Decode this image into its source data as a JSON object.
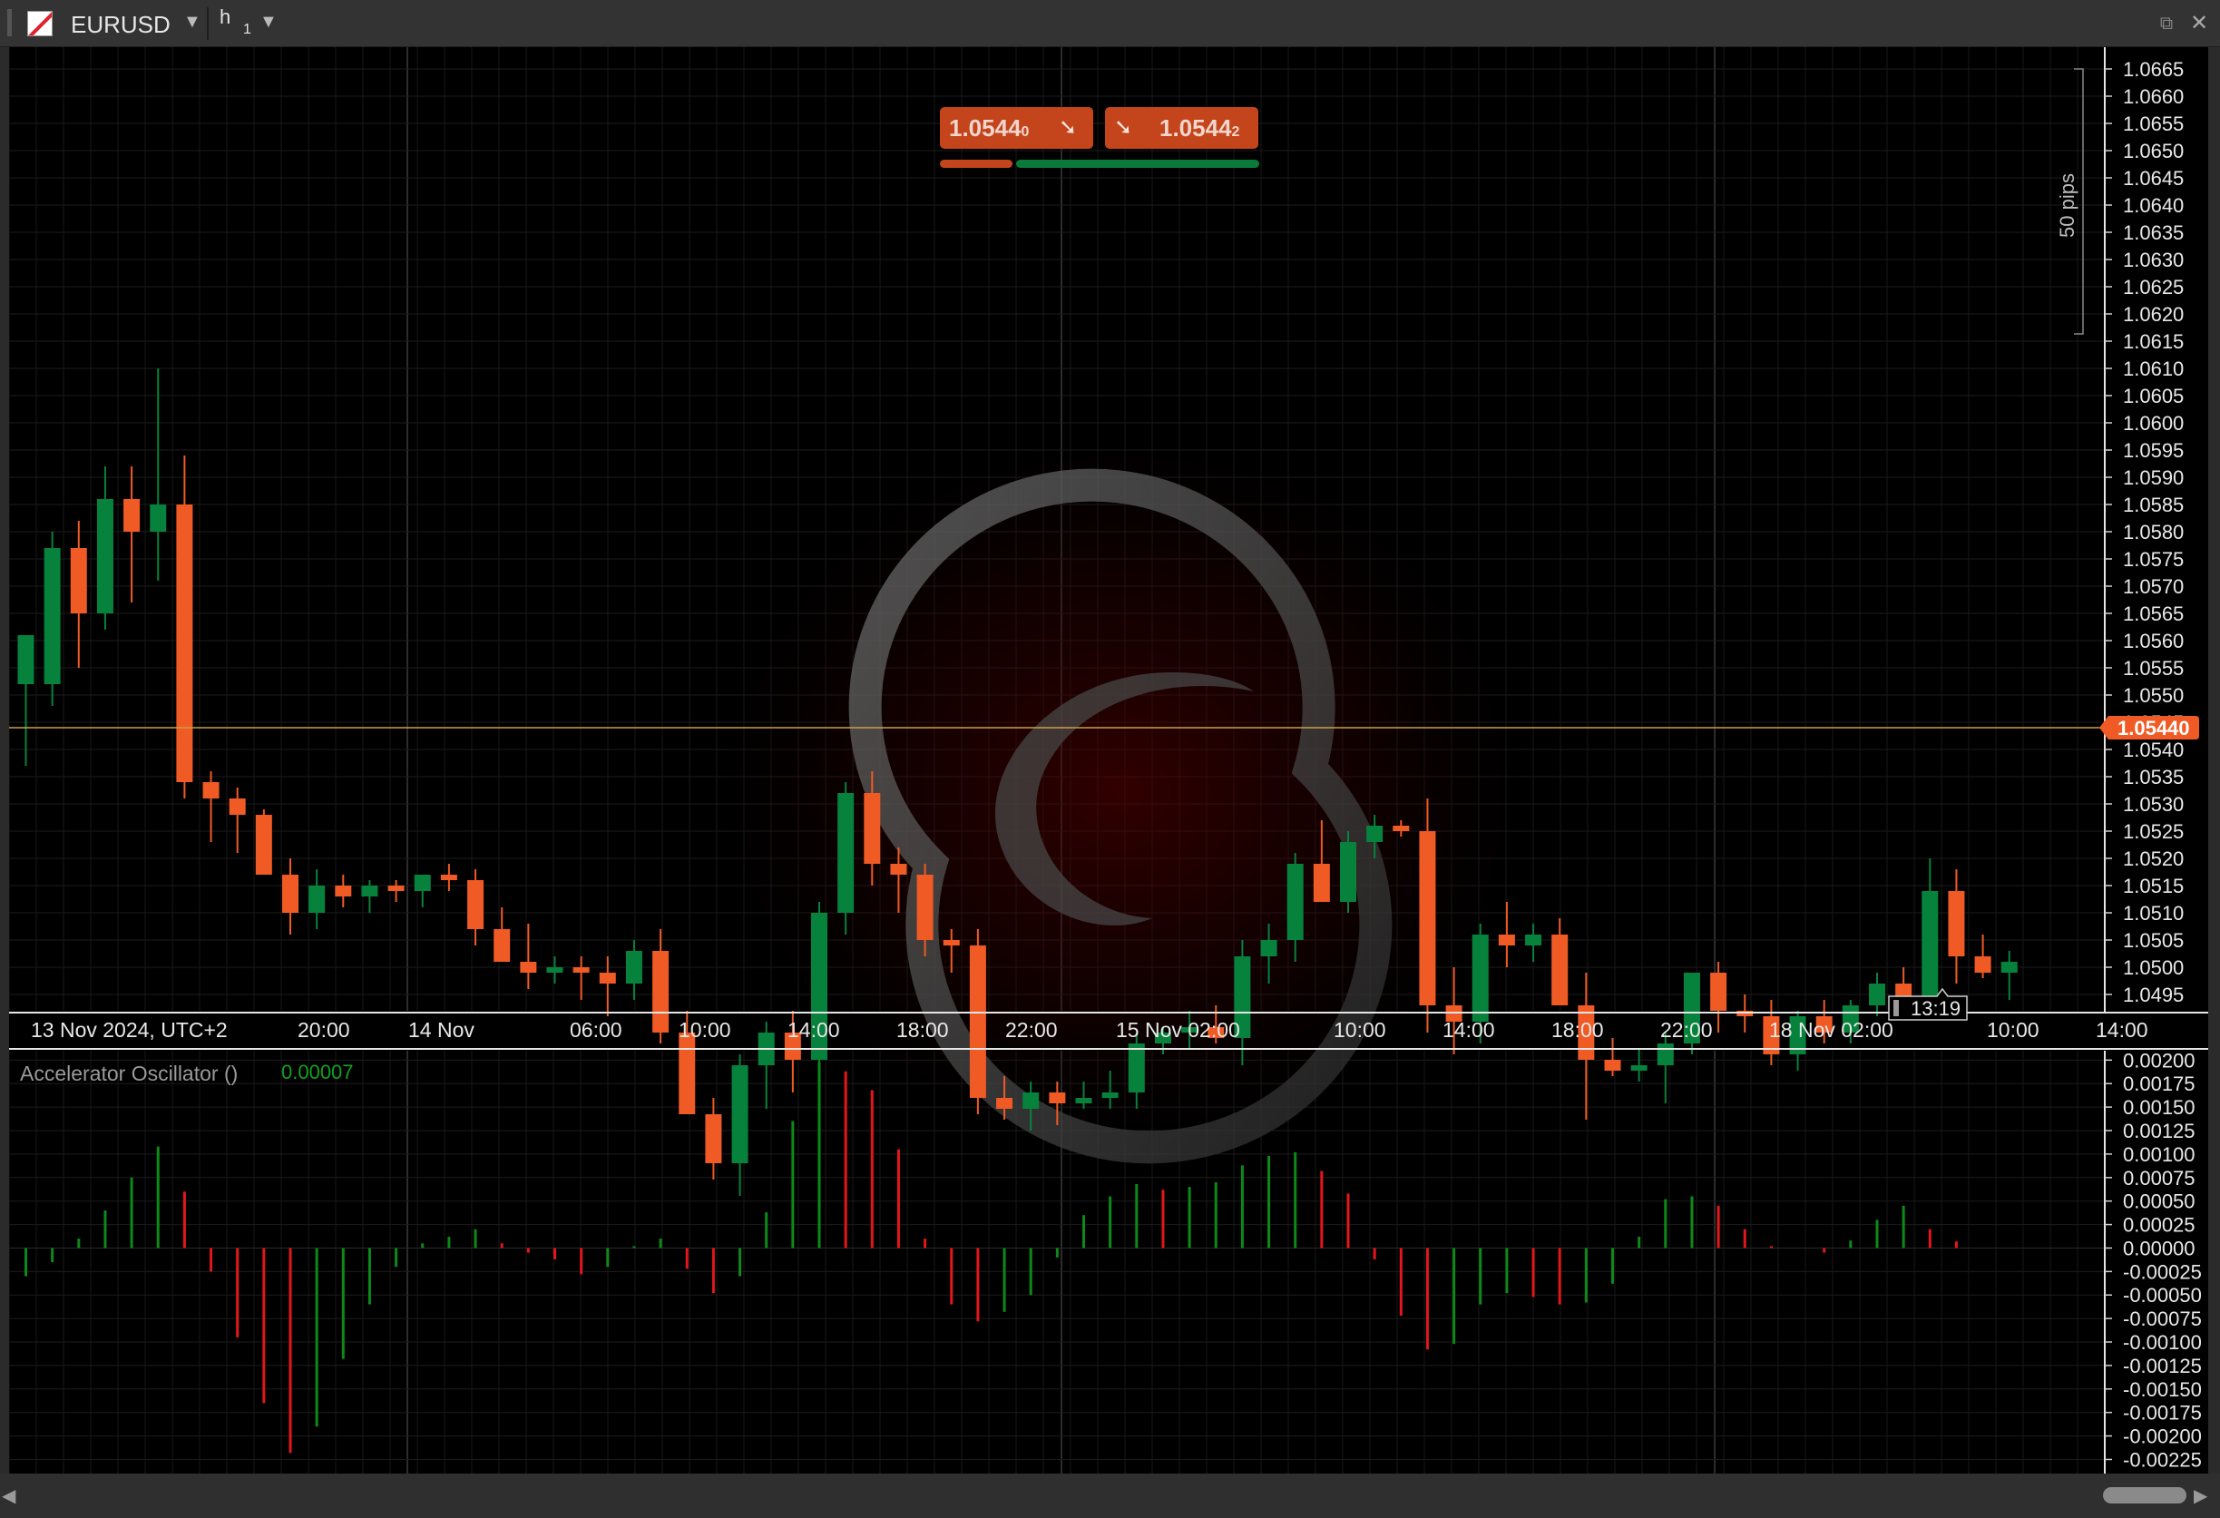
{
  "window": {
    "symbol": "EURUSD",
    "timeframe_letter": "h",
    "timeframe_number": "1"
  },
  "trade": {
    "sell_price_main": "1.0544",
    "sell_price_pip": "0",
    "buy_price_main": "1.0544",
    "buy_price_pip": "2"
  },
  "chart_data": [
    {
      "type": "candlestick",
      "series_name": "EURUSD h1",
      "current_price_label": "1.05440",
      "current_price": 1.0544,
      "pips_label": "50 pips",
      "countdown_label": "13:19",
      "colors": {
        "up": "#07823c",
        "down": "#f05a24",
        "background": "#000000",
        "price_line": "#c8a04a"
      },
      "ylim": [
        1.0492,
        1.0669
      ],
      "y_ticks": [
        "1.0665",
        "1.0660",
        "1.0655",
        "1.0650",
        "1.0645",
        "1.0640",
        "1.0635",
        "1.0630",
        "1.0625",
        "1.0620",
        "1.0615",
        "1.0610",
        "1.0605",
        "1.0600",
        "1.0595",
        "1.0590",
        "1.0585",
        "1.0580",
        "1.0575",
        "1.0570",
        "1.0565",
        "1.0560",
        "1.0555",
        "1.0550",
        "1.0545",
        "1.0540",
        "1.0535",
        "1.0530",
        "1.0525",
        "1.0520",
        "1.0515",
        "1.0510",
        "1.0505",
        "1.0500",
        "1.0495"
      ],
      "x_ticks": [
        "13 Nov 2024, UTC+2",
        "20:00",
        "14 Nov",
        "06:00",
        "10:00",
        "14:00",
        "18:00",
        "22:00",
        "15 Nov 02:00",
        "10:00",
        "14:00",
        "18:00",
        "22:00",
        "18 Nov 02:00",
        "10:00",
        "14:00"
      ],
      "candles": [
        {
          "o": 1.0552,
          "h": 1.0561,
          "l": 1.0537,
          "c": 1.0561
        },
        {
          "o": 1.0552,
          "h": 1.058,
          "l": 1.0548,
          "c": 1.0577
        },
        {
          "o": 1.0577,
          "h": 1.0582,
          "l": 1.0555,
          "c": 1.0565
        },
        {
          "o": 1.0565,
          "h": 1.0592,
          "l": 1.0562,
          "c": 1.0586
        },
        {
          "o": 1.0586,
          "h": 1.0592,
          "l": 1.0567,
          "c": 1.058
        },
        {
          "o": 1.058,
          "h": 1.061,
          "l": 1.0571,
          "c": 1.0585
        },
        {
          "o": 1.0585,
          "h": 1.0594,
          "l": 1.0531,
          "c": 1.0534
        },
        {
          "o": 1.0534,
          "h": 1.0536,
          "l": 1.0523,
          "c": 1.0531
        },
        {
          "o": 1.0531,
          "h": 1.0533,
          "l": 1.0521,
          "c": 1.0528
        },
        {
          "o": 1.0528,
          "h": 1.0529,
          "l": 1.0518,
          "c": 1.0517
        },
        {
          "o": 1.0517,
          "h": 1.052,
          "l": 1.0506,
          "c": 1.051
        },
        {
          "o": 1.051,
          "h": 1.0518,
          "l": 1.0507,
          "c": 1.0515
        },
        {
          "o": 1.0515,
          "h": 1.0517,
          "l": 1.0511,
          "c": 1.0513
        },
        {
          "o": 1.0513,
          "h": 1.0516,
          "l": 1.051,
          "c": 1.0515
        },
        {
          "o": 1.0515,
          "h": 1.0516,
          "l": 1.0512,
          "c": 1.0514
        },
        {
          "o": 1.0514,
          "h": 1.0517,
          "l": 1.0511,
          "c": 1.0517
        },
        {
          "o": 1.0517,
          "h": 1.0519,
          "l": 1.0514,
          "c": 1.0516
        },
        {
          "o": 1.0516,
          "h": 1.0518,
          "l": 1.0504,
          "c": 1.0507
        },
        {
          "o": 1.0507,
          "h": 1.0511,
          "l": 1.0501,
          "c": 1.0501
        },
        {
          "o": 1.0501,
          "h": 1.0508,
          "l": 1.0496,
          "c": 1.0499
        },
        {
          "o": 1.0499,
          "h": 1.0502,
          "l": 1.0497,
          "c": 1.05
        },
        {
          "o": 1.05,
          "h": 1.0502,
          "l": 1.0494,
          "c": 1.0499
        },
        {
          "o": 1.0499,
          "h": 1.0502,
          "l": 1.0491,
          "c": 1.0497
        },
        {
          "o": 1.0497,
          "h": 1.0505,
          "l": 1.0494,
          "c": 1.0503
        },
        {
          "o": 1.0503,
          "h": 1.0507,
          "l": 1.0486,
          "c": 1.0488
        },
        {
          "o": 1.0488,
          "h": 1.0492,
          "l": 1.0474,
          "c": 1.0473
        },
        {
          "o": 1.0473,
          "h": 1.0476,
          "l": 1.0461,
          "c": 1.0464
        },
        {
          "o": 1.0464,
          "h": 1.0484,
          "l": 1.0458,
          "c": 1.0482
        },
        {
          "o": 1.0482,
          "h": 1.049,
          "l": 1.0474,
          "c": 1.0488
        },
        {
          "o": 1.0488,
          "h": 1.0492,
          "l": 1.0477,
          "c": 1.0483
        },
        {
          "o": 1.0483,
          "h": 1.0512,
          "l": 1.0481,
          "c": 1.051
        },
        {
          "o": 1.051,
          "h": 1.0534,
          "l": 1.0506,
          "c": 1.0532
        },
        {
          "o": 1.0532,
          "h": 1.0536,
          "l": 1.0515,
          "c": 1.0519
        },
        {
          "o": 1.0519,
          "h": 1.0522,
          "l": 1.051,
          "c": 1.0517
        },
        {
          "o": 1.0517,
          "h": 1.0519,
          "l": 1.0502,
          "c": 1.0505
        },
        {
          "o": 1.0505,
          "h": 1.0507,
          "l": 1.0499,
          "c": 1.0504
        },
        {
          "o": 1.0504,
          "h": 1.0507,
          "l": 1.0473,
          "c": 1.0476
        },
        {
          "o": 1.0476,
          "h": 1.048,
          "l": 1.0472,
          "c": 1.0474
        },
        {
          "o": 1.0474,
          "h": 1.0479,
          "l": 1.047,
          "c": 1.0477
        },
        {
          "o": 1.0477,
          "h": 1.0479,
          "l": 1.0471,
          "c": 1.0475
        },
        {
          "o": 1.0475,
          "h": 1.0479,
          "l": 1.0474,
          "c": 1.0476
        },
        {
          "o": 1.0476,
          "h": 1.0481,
          "l": 1.0474,
          "c": 1.0477
        },
        {
          "o": 1.0477,
          "h": 1.0488,
          "l": 1.0474,
          "c": 1.0486
        },
        {
          "o": 1.0486,
          "h": 1.0489,
          "l": 1.0484,
          "c": 1.0488
        },
        {
          "o": 1.0488,
          "h": 1.0492,
          "l": 1.0485,
          "c": 1.0489
        },
        {
          "o": 1.0489,
          "h": 1.0493,
          "l": 1.0486,
          "c": 1.0487
        },
        {
          "o": 1.0487,
          "h": 1.0505,
          "l": 1.0482,
          "c": 1.0502
        },
        {
          "o": 1.0502,
          "h": 1.0508,
          "l": 1.0497,
          "c": 1.0505
        },
        {
          "o": 1.0505,
          "h": 1.0521,
          "l": 1.0501,
          "c": 1.0519
        },
        {
          "o": 1.0519,
          "h": 1.0527,
          "l": 1.0512,
          "c": 1.0512
        },
        {
          "o": 1.0512,
          "h": 1.0525,
          "l": 1.051,
          "c": 1.0523
        },
        {
          "o": 1.0523,
          "h": 1.0528,
          "l": 1.052,
          "c": 1.0526
        },
        {
          "o": 1.0526,
          "h": 1.0527,
          "l": 1.0524,
          "c": 1.0525
        },
        {
          "o": 1.0525,
          "h": 1.0531,
          "l": 1.0488,
          "c": 1.0493
        },
        {
          "o": 1.0493,
          "h": 1.05,
          "l": 1.0484,
          "c": 1.049
        },
        {
          "o": 1.049,
          "h": 1.0508,
          "l": 1.0486,
          "c": 1.0506
        },
        {
          "o": 1.0506,
          "h": 1.0512,
          "l": 1.05,
          "c": 1.0504
        },
        {
          "o": 1.0504,
          "h": 1.0508,
          "l": 1.0501,
          "c": 1.0506
        },
        {
          "o": 1.0506,
          "h": 1.0509,
          "l": 1.0493,
          "c": 1.0493
        },
        {
          "o": 1.0493,
          "h": 1.0499,
          "l": 1.0472,
          "c": 1.0483
        },
        {
          "o": 1.0483,
          "h": 1.0487,
          "l": 1.048,
          "c": 1.0481
        },
        {
          "o": 1.0481,
          "h": 1.0485,
          "l": 1.0479,
          "c": 1.0482
        },
        {
          "o": 1.0482,
          "h": 1.0488,
          "l": 1.0475,
          "c": 1.0486
        },
        {
          "o": 1.0486,
          "h": 1.0499,
          "l": 1.0484,
          "c": 1.0499
        },
        {
          "o": 1.0499,
          "h": 1.0501,
          "l": 1.0488,
          "c": 1.0492
        },
        {
          "o": 1.0492,
          "h": 1.0495,
          "l": 1.0488,
          "c": 1.0491
        },
        {
          "o": 1.0491,
          "h": 1.0494,
          "l": 1.0482,
          "c": 1.0484
        },
        {
          "o": 1.0484,
          "h": 1.0492,
          "l": 1.0481,
          "c": 1.0491
        },
        {
          "o": 1.0491,
          "h": 1.0494,
          "l": 1.0486,
          "c": 1.0488
        },
        {
          "o": 1.0488,
          "h": 1.0494,
          "l": 1.0486,
          "c": 1.0493
        },
        {
          "o": 1.0493,
          "h": 1.0499,
          "l": 1.0491,
          "c": 1.0497
        },
        {
          "o": 1.0497,
          "h": 1.05,
          "l": 1.0491,
          "c": 1.0494
        },
        {
          "o": 1.0494,
          "h": 1.052,
          "l": 1.0493,
          "c": 1.0514
        },
        {
          "o": 1.0514,
          "h": 1.0518,
          "l": 1.0497,
          "c": 1.0502
        },
        {
          "o": 1.0502,
          "h": 1.0506,
          "l": 1.0498,
          "c": 1.0499
        },
        {
          "o": 1.0499,
          "h": 1.0503,
          "l": 1.0494,
          "c": 1.0501
        }
      ]
    },
    {
      "type": "bar",
      "title": "Accelerator Oscillator ()",
      "last_value": "0.00007",
      "colors": {
        "up": "#0c8a18",
        "down": "#e3161c"
      },
      "ylim": [
        -0.0024,
        0.0021
      ],
      "y_ticks": [
        "0.00200",
        "0.00175",
        "0.00150",
        "0.00125",
        "0.00100",
        "0.00075",
        "0.00050",
        "0.00025",
        "0.00000",
        "-0.00025",
        "-0.00050",
        "-0.00075",
        "-0.00100",
        "-0.00125",
        "-0.00150",
        "-0.00175",
        "-0.00200",
        "-0.00225"
      ],
      "values": [
        -0.0003,
        -0.00015,
        0.0001,
        0.0004,
        0.00075,
        0.00108,
        0.0006,
        -0.00025,
        -0.00095,
        -0.00165,
        -0.00218,
        -0.0019,
        -0.00118,
        -0.0006,
        -0.0002,
        5e-05,
        0.00012,
        0.0002,
        5e-05,
        -5e-05,
        -0.00012,
        -0.00028,
        -0.0002,
        2e-05,
        0.0001,
        -0.00022,
        -0.00048,
        -0.0003,
        0.00038,
        0.00135,
        0.00198,
        0.00188,
        0.00168,
        0.00105,
        0.0001,
        -0.0006,
        -0.00078,
        -0.00068,
        -0.0005,
        -0.0001,
        0.00035,
        0.00055,
        0.00068,
        0.00062,
        0.00065,
        0.0007,
        0.00088,
        0.00098,
        0.00102,
        0.00082,
        0.00058,
        -0.00012,
        -0.00072,
        -0.00108,
        -0.00102,
        -0.0006,
        -0.00048,
        -0.00052,
        -0.0006,
        -0.00058,
        -0.00038,
        0.00012,
        0.00052,
        0.00055,
        0.00045,
        0.0002,
        2e-05,
        0.0,
        -5e-05,
        8e-05,
        0.0003,
        0.00045,
        0.0002,
        7e-05
      ]
    }
  ]
}
